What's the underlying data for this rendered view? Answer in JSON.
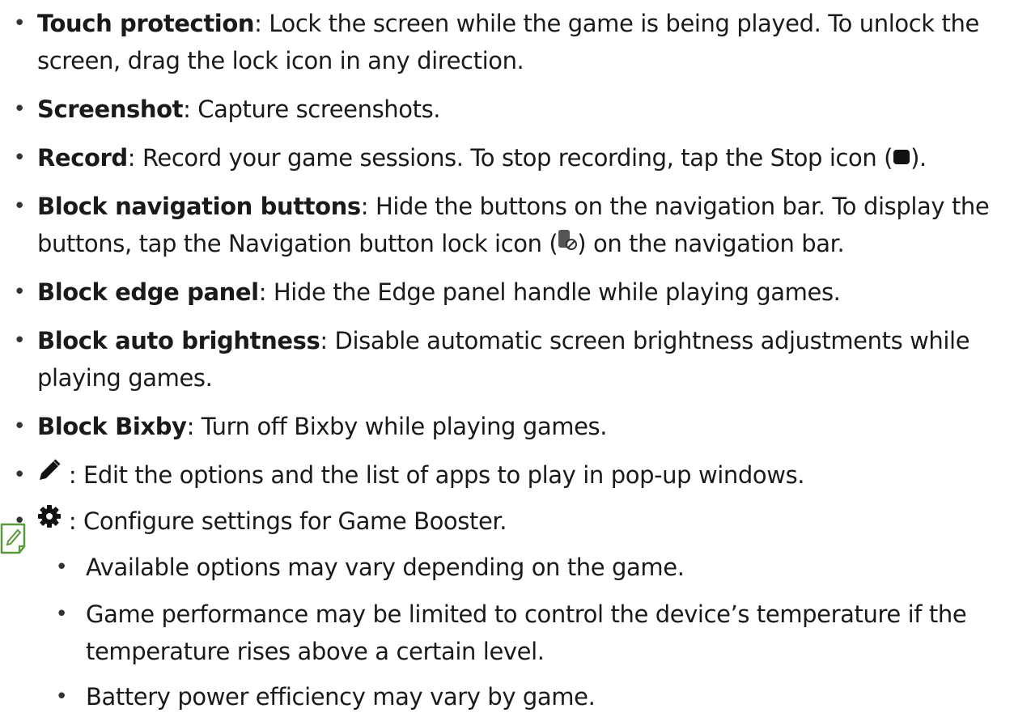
{
  "items": [
    {
      "term": "Touch protection",
      "line1": ": Lock the screen while the game is being played. To unlock the",
      "line2": "screen, drag the lock icon in any direction."
    },
    {
      "term": "Screenshot",
      "line1": ": Capture screenshots."
    },
    {
      "term": "Record",
      "line1_before": ": Record your game sessions. To stop recording, tap the Stop icon (",
      "icon": "stop-icon",
      "line1_after": ")."
    },
    {
      "term": "Block navigation buttons",
      "line1": ": Hide the buttons on the navigation bar. To display the",
      "line2_before": "buttons, tap the Navigation button lock icon (",
      "icon": "navigation-button-lock-icon",
      "line2_after": ") on the navigation bar."
    },
    {
      "term": "Block edge panel",
      "line1": ": Hide the Edge panel handle while playing games."
    },
    {
      "term": "Block auto brightness",
      "line1": ": Disable automatic screen brightness adjustments while",
      "line2": "playing games."
    },
    {
      "term": "Block Bixby",
      "line1": ": Turn off Bixby while playing games."
    },
    {
      "icon": "pencil-icon",
      "line1": " : Edit the options and the list of apps to play in pop-up windows."
    },
    {
      "icon": "gear-icon",
      "line1": " : Configure settings for Game Booster."
    }
  ],
  "note": {
    "icon": "note-icon",
    "icon_color": "#5a9a3a",
    "items": [
      {
        "line1": "Available options may vary depending on the game."
      },
      {
        "line1": "Game performance may be limited to control the device’s temperature if the",
        "line2": "temperature rises above a certain level."
      },
      {
        "line1": "Battery power efficiency may vary by game."
      }
    ]
  },
  "bullet_char": "•"
}
